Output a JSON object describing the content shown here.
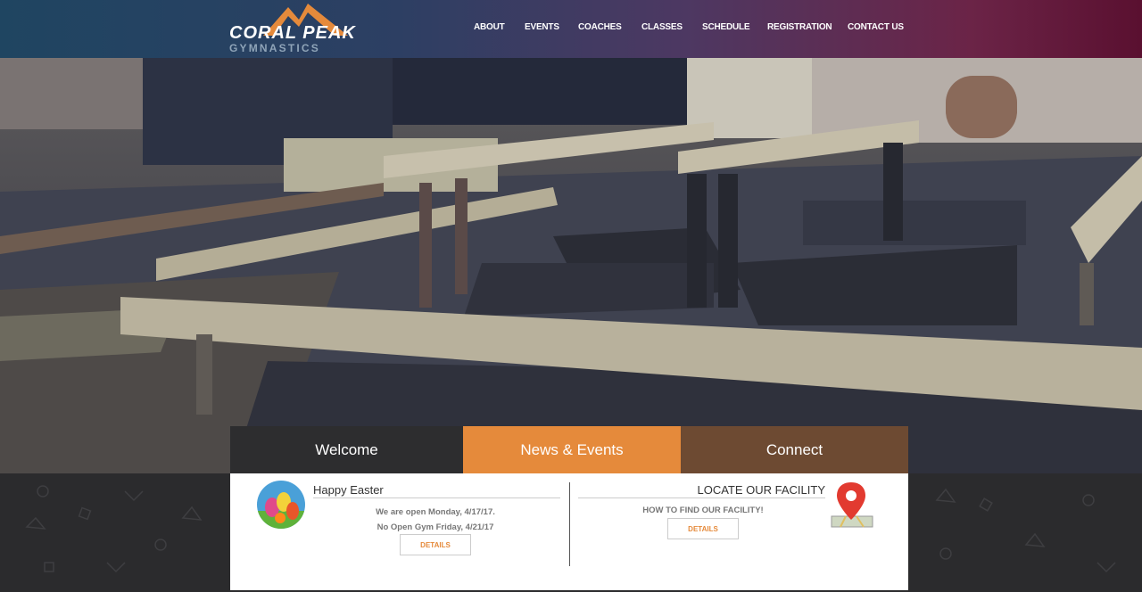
{
  "brand": {
    "name_line1": "CORAL PEAK",
    "name_line2": "GYMNASTICS"
  },
  "nav": {
    "items": [
      {
        "label": "ABOUT"
      },
      {
        "label": "EVENTS"
      },
      {
        "label": "COACHES"
      },
      {
        "label": "CLASSES"
      },
      {
        "label": "SCHEDULE"
      },
      {
        "label": "REGISTRATION"
      },
      {
        "label": "CONTACT US"
      }
    ]
  },
  "tabs": [
    {
      "label": "Welcome"
    },
    {
      "label": "News & Events"
    },
    {
      "label": "Connect"
    }
  ],
  "event": {
    "title": "Happy Easter",
    "line1": "We are open Monday, 4/17/17.",
    "line2": "No Open Gym Friday, 4/21/17",
    "button": "DETAILS"
  },
  "facility": {
    "title": "LOCATE OUR FACILITY",
    "subtitle": "HOW TO FIND OUR FACILITY!",
    "button": "DETAILS"
  },
  "colors": {
    "accent": "#e58a3b",
    "connect": "#6d4a32",
    "welcome": "#2d2d2f"
  },
  "icons": [
    "mountain-logo-icon",
    "easter-eggs-image",
    "map-pin-icon"
  ]
}
